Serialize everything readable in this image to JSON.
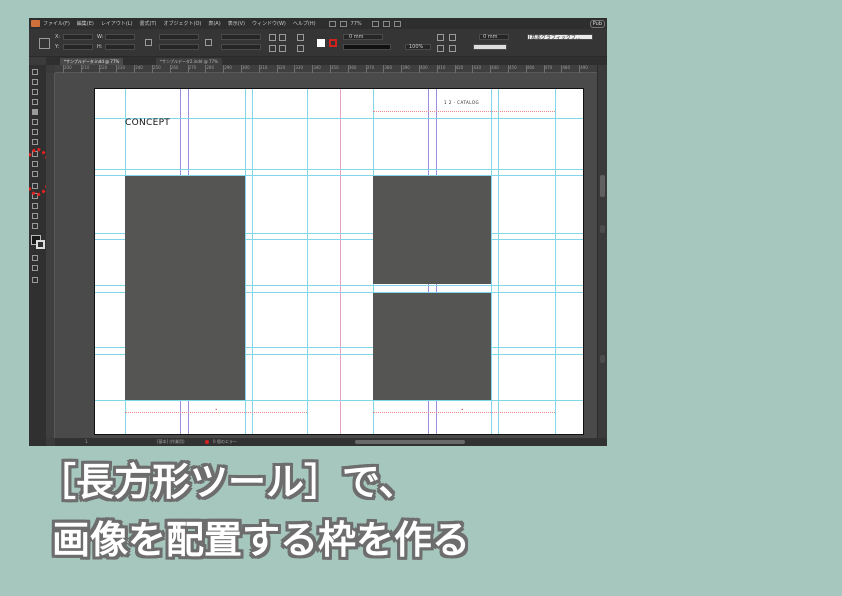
{
  "menubar": {
    "items": [
      "ファイル(F)",
      "編集(E)",
      "レイアウト(L)",
      "書式(T)",
      "オブジェクト(O)",
      "表(A)",
      "表示(V)",
      "ウィンドウ(W)",
      "ヘルプ(H)"
    ],
    "zoom": "77%",
    "publish_label": "Pub"
  },
  "control": {
    "x_label": "X:",
    "y_label": "Y:",
    "w_label": "W:",
    "h_label": "H:",
    "stroke_weight": "0 mm",
    "percent": "100%",
    "spacing": "0 mm",
    "style_select": "[基本グラフィックフ..."
  },
  "tabs": [
    {
      "label": "*サンプルデータ.indd @ 77%",
      "active": true
    },
    {
      "label": "*サンプルデータ2.indd @ 77%",
      "active": false
    }
  ],
  "ruler": {
    "labels": [
      "200",
      "210",
      "220",
      "230",
      "240",
      "250",
      "260",
      "270",
      "280",
      "290",
      "300",
      "310",
      "320",
      "330",
      "340",
      "350",
      "360",
      "370",
      "380",
      "390",
      "400",
      "410",
      "420",
      "430",
      "440",
      "450",
      "460",
      "470",
      "480",
      "490"
    ]
  },
  "document": {
    "heading": "CONCEPT",
    "running_head": "1 2 · CATALOG"
  },
  "status": {
    "page": "1",
    "style": "[基本] (作業用)",
    "errors": "0 個のエラー"
  },
  "caption": {
    "line1": "［長方形ツール］で、",
    "line2": "画像を配置する枠を作る"
  },
  "colors": {
    "background": "#a6c7be",
    "frame_fill": "#555653",
    "highlight": "#e62020",
    "guide": "#7fd7e8"
  }
}
